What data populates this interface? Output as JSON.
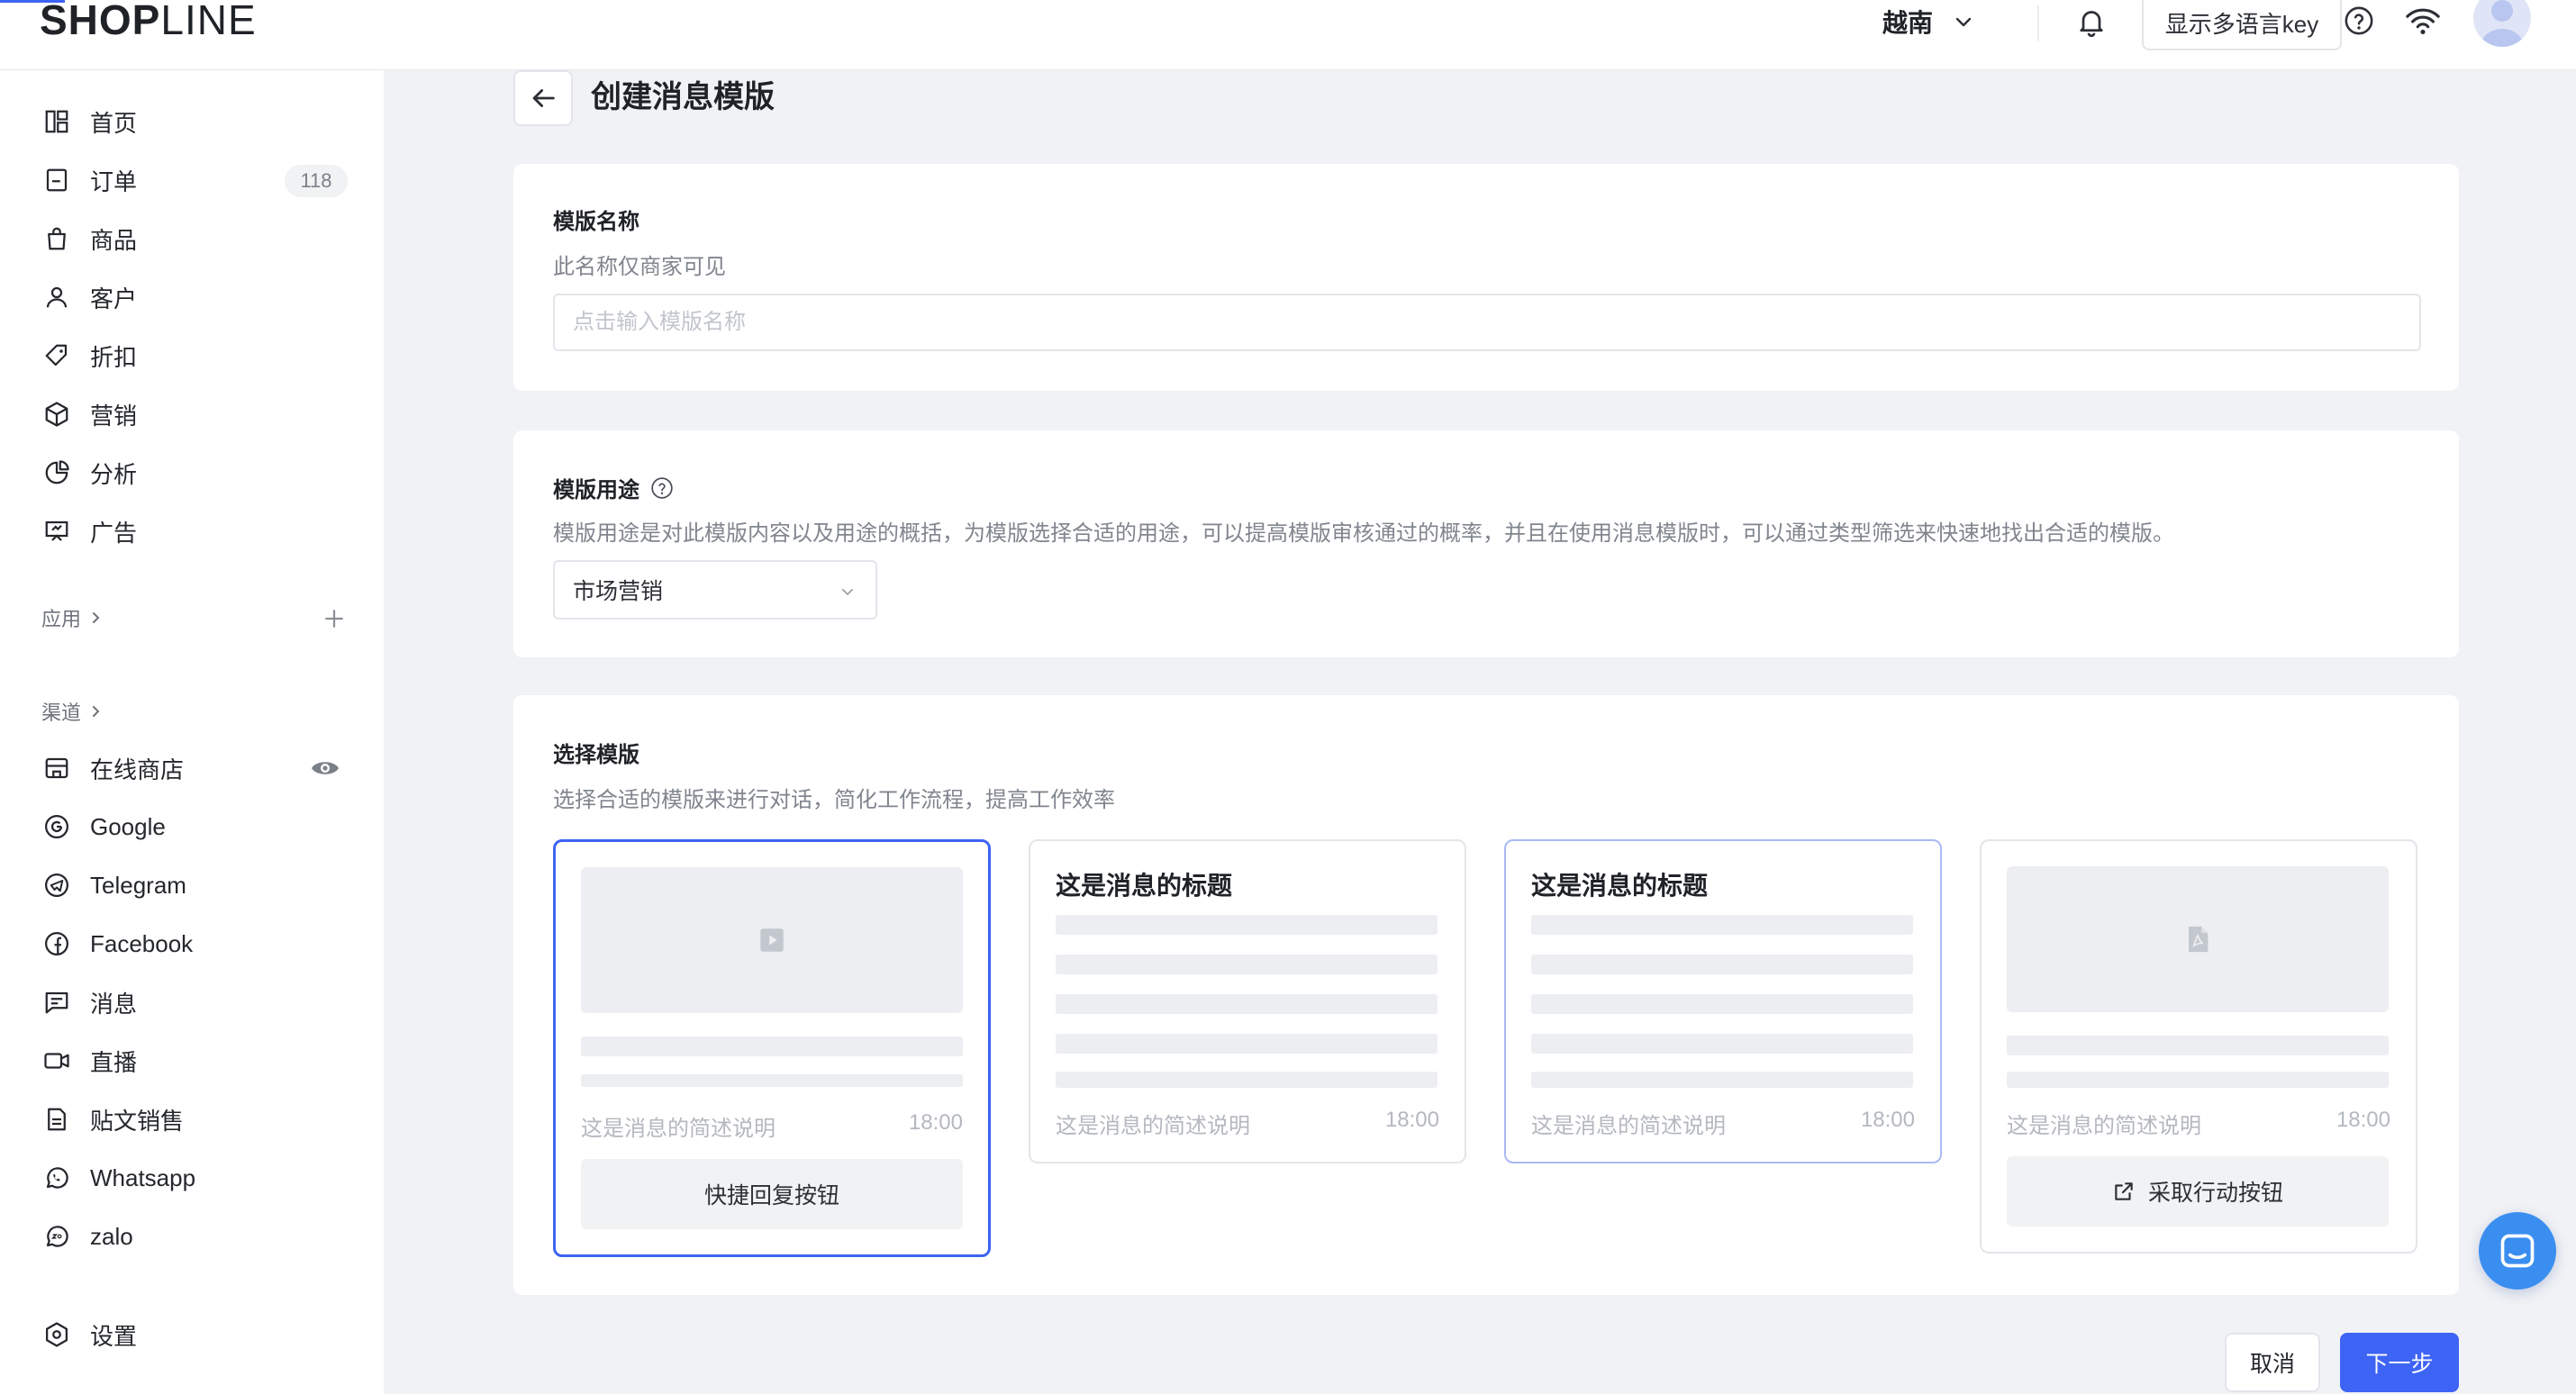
{
  "header": {
    "logo": {
      "bold": "SHOP",
      "light": "LINE"
    },
    "region": "越南",
    "multilang_key_button": "显示多语言key",
    "icons": [
      "bell-icon",
      "help-icon",
      "wifi-icon",
      "avatar"
    ]
  },
  "sidebar": {
    "items": [
      {
        "label": "首页",
        "icon": "home-icon"
      },
      {
        "label": "订单",
        "icon": "order-icon",
        "badge": "118"
      },
      {
        "label": "商品",
        "icon": "bag-icon"
      },
      {
        "label": "客户",
        "icon": "user-icon"
      },
      {
        "label": "折扣",
        "icon": "tag-icon"
      },
      {
        "label": "营销",
        "icon": "cube-icon"
      },
      {
        "label": "分析",
        "icon": "pie-icon"
      },
      {
        "label": "广告",
        "icon": "billboard-icon"
      }
    ],
    "apps_label": "应用",
    "channels_label": "渠道",
    "channels": [
      {
        "label": "在线商店",
        "icon": "store-icon"
      },
      {
        "label": "Google",
        "icon": "google-icon"
      },
      {
        "label": "Telegram",
        "icon": "telegram-icon"
      },
      {
        "label": "Facebook",
        "icon": "facebook-icon"
      },
      {
        "label": "消息",
        "icon": "message-icon"
      },
      {
        "label": "直播",
        "icon": "video-icon"
      },
      {
        "label": "贴文销售",
        "icon": "post-icon"
      },
      {
        "label": "Whatsapp",
        "icon": "whatsapp-icon"
      },
      {
        "label": "zalo",
        "icon": "zalo-icon"
      }
    ],
    "settings_label": "设置"
  },
  "page": {
    "title": "创建消息模版"
  },
  "name_card": {
    "title": "模版名称",
    "desc": "此名称仅商家可见",
    "placeholder": "点击输入模版名称",
    "value": ""
  },
  "usage_card": {
    "title": "模版用途",
    "desc": "模版用途是对此模版内容以及用途的概括，为模版选择合适的用途，可以提高模版审核通过的概率，并且在使用消息模版时，可以通过类型筛选来快速地找出合适的模版。",
    "selected": "市场营销"
  },
  "template_card": {
    "title": "选择模版",
    "desc": "选择合适的模版来进行对话，简化工作流程，提高工作效率",
    "templates": [
      {
        "type": "video",
        "desc": "这是消息的简述说明",
        "time": "18:00",
        "button": "快捷回复按钮",
        "state": "selected"
      },
      {
        "type": "text",
        "title": "这是消息的标题",
        "desc": "这是消息的简述说明",
        "time": "18:00",
        "state": "default"
      },
      {
        "type": "text",
        "title": "这是消息的标题",
        "desc": "这是消息的简述说明",
        "time": "18:00",
        "state": "hover"
      },
      {
        "type": "document",
        "desc": "这是消息的简述说明",
        "time": "18:00",
        "button": "采取行动按钮",
        "state": "default"
      }
    ]
  },
  "footer": {
    "cancel": "取消",
    "next": "下一步"
  },
  "colors": {
    "primary": "#3d64f4",
    "background": "#f1f2f5",
    "chat_fab": "#3a8ef0"
  }
}
